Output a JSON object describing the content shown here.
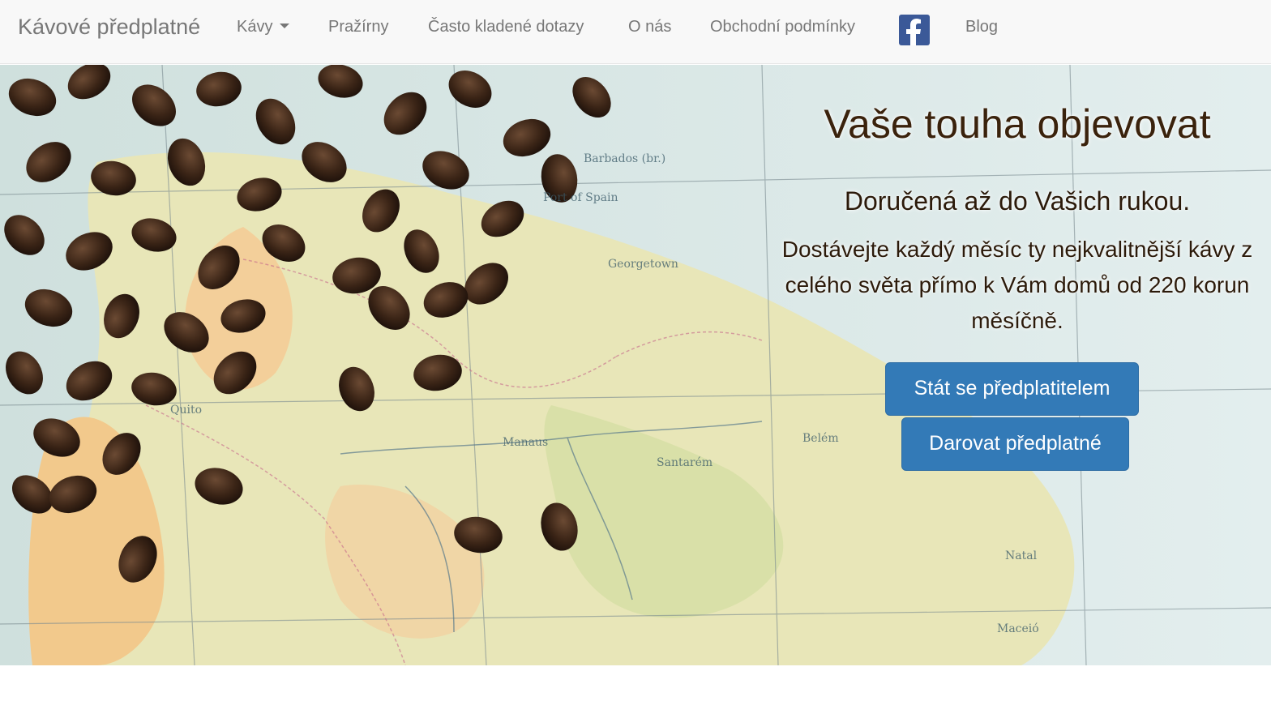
{
  "navbar": {
    "brand": "Kávové předplatné",
    "items": [
      {
        "label": "Kávy",
        "dropdown": true
      },
      {
        "label": "Pražírny"
      },
      {
        "label": "Často kladené dotazy"
      },
      {
        "label": "O nás"
      },
      {
        "label": "Obchodní podmínky"
      },
      {
        "label": "Blog"
      }
    ],
    "facebook_icon": "facebook-icon"
  },
  "hero": {
    "title": "Vaše touha objevovat",
    "subtitle": "Doručená až do Vašich rukou.",
    "description": "Dostávejte každý měsíc ty nejkvalitnější kávy z celého světa přímo k Vám domů od 220 korun měsíčně.",
    "primary_button": "Stát se předplatitelem",
    "secondary_button": "Darovat předplatné",
    "colors": {
      "button": "#337ab7",
      "title": "#3a220c"
    }
  }
}
